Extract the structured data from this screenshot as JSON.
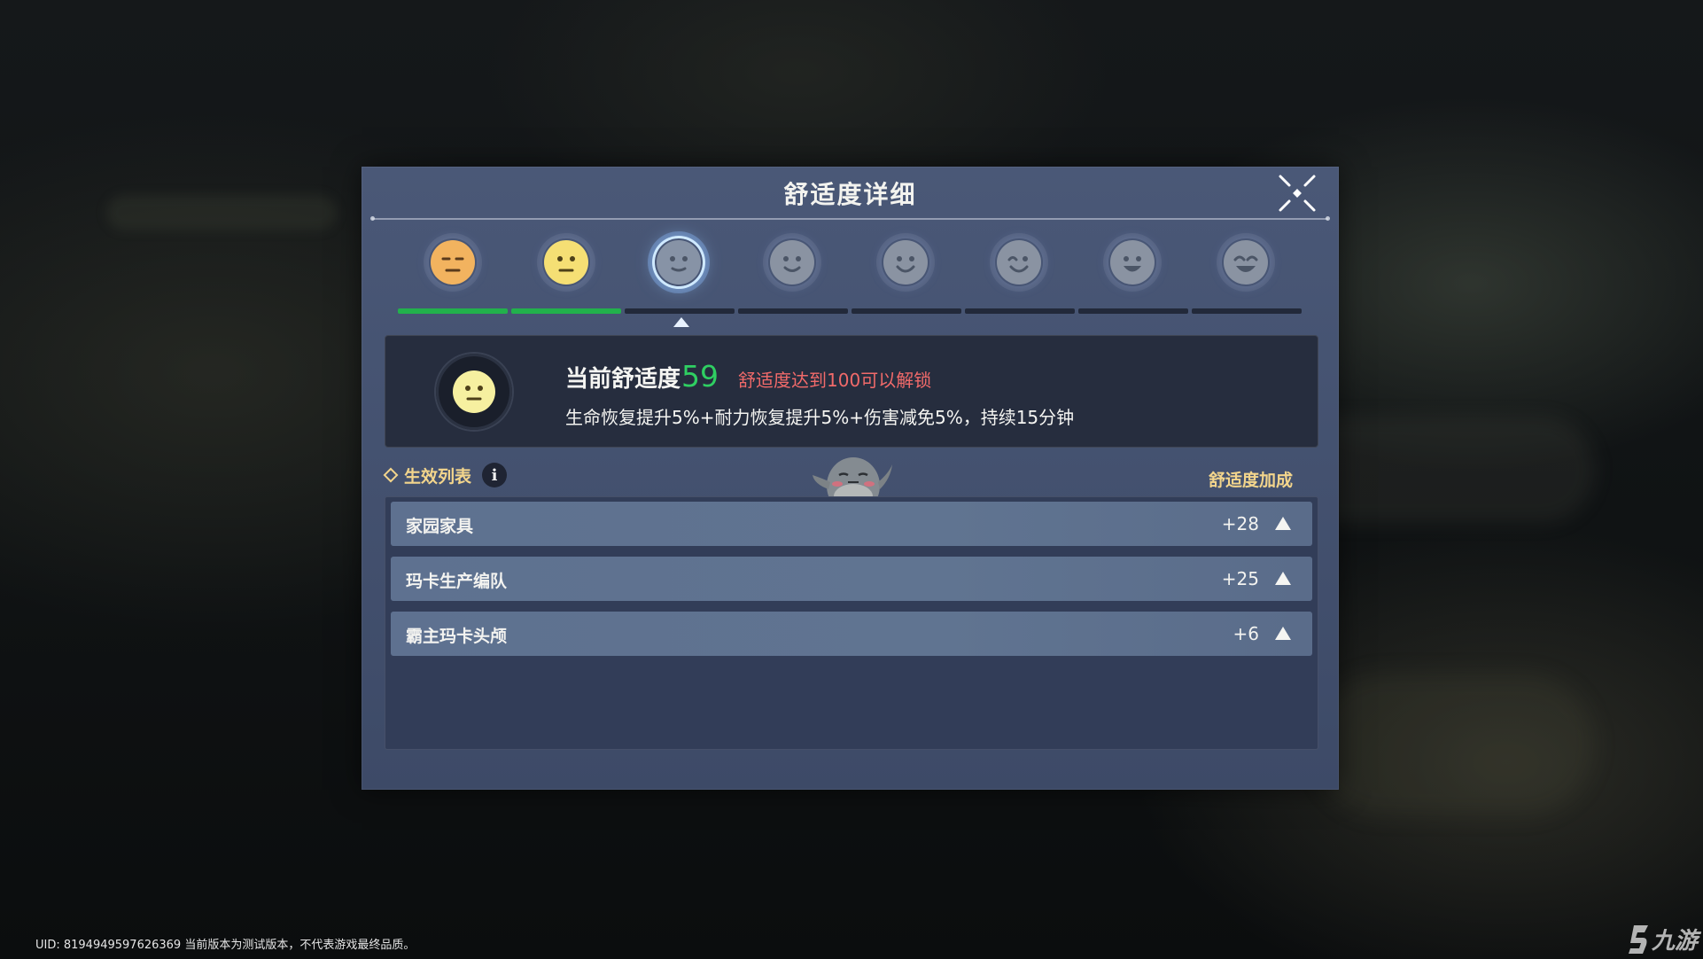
{
  "panel": {
    "title": "舒适度详细"
  },
  "comfort": {
    "label": "当前舒适度",
    "value": "59",
    "level": 59,
    "max": 100,
    "unlock_hint": "舒适度达到100可以解锁",
    "effect": "生命恢复提升5%+耐力恢复提升5%+伤害减免5%，持续15分钟",
    "current_stage_index": 2,
    "stages_total": 8,
    "stages_filled": 2
  },
  "list": {
    "title": "生效列表",
    "bonus_header": "舒适度加成",
    "items": [
      {
        "label": "家园家具",
        "value": "+28"
      },
      {
        "label": "玛卡生产编队",
        "value": "+25"
      },
      {
        "label": "霸主玛卡头颅",
        "value": "+6"
      }
    ]
  },
  "footer": {
    "uid": "UID: 8194949597626369 当前版本为测试版本，不代表游戏最终品质。"
  },
  "watermark": {
    "text": "九游"
  },
  "colors": {
    "accent_green": "#2fcf62",
    "warning_red": "#f16a6a",
    "header_gold": "#f3d58c",
    "panel_bg": "#4a5877"
  },
  "icons": {
    "close": "close-x-icon",
    "info": "info-icon",
    "list_bullet": "diamond-icon",
    "row_toggle": "triangle-up-icon"
  }
}
